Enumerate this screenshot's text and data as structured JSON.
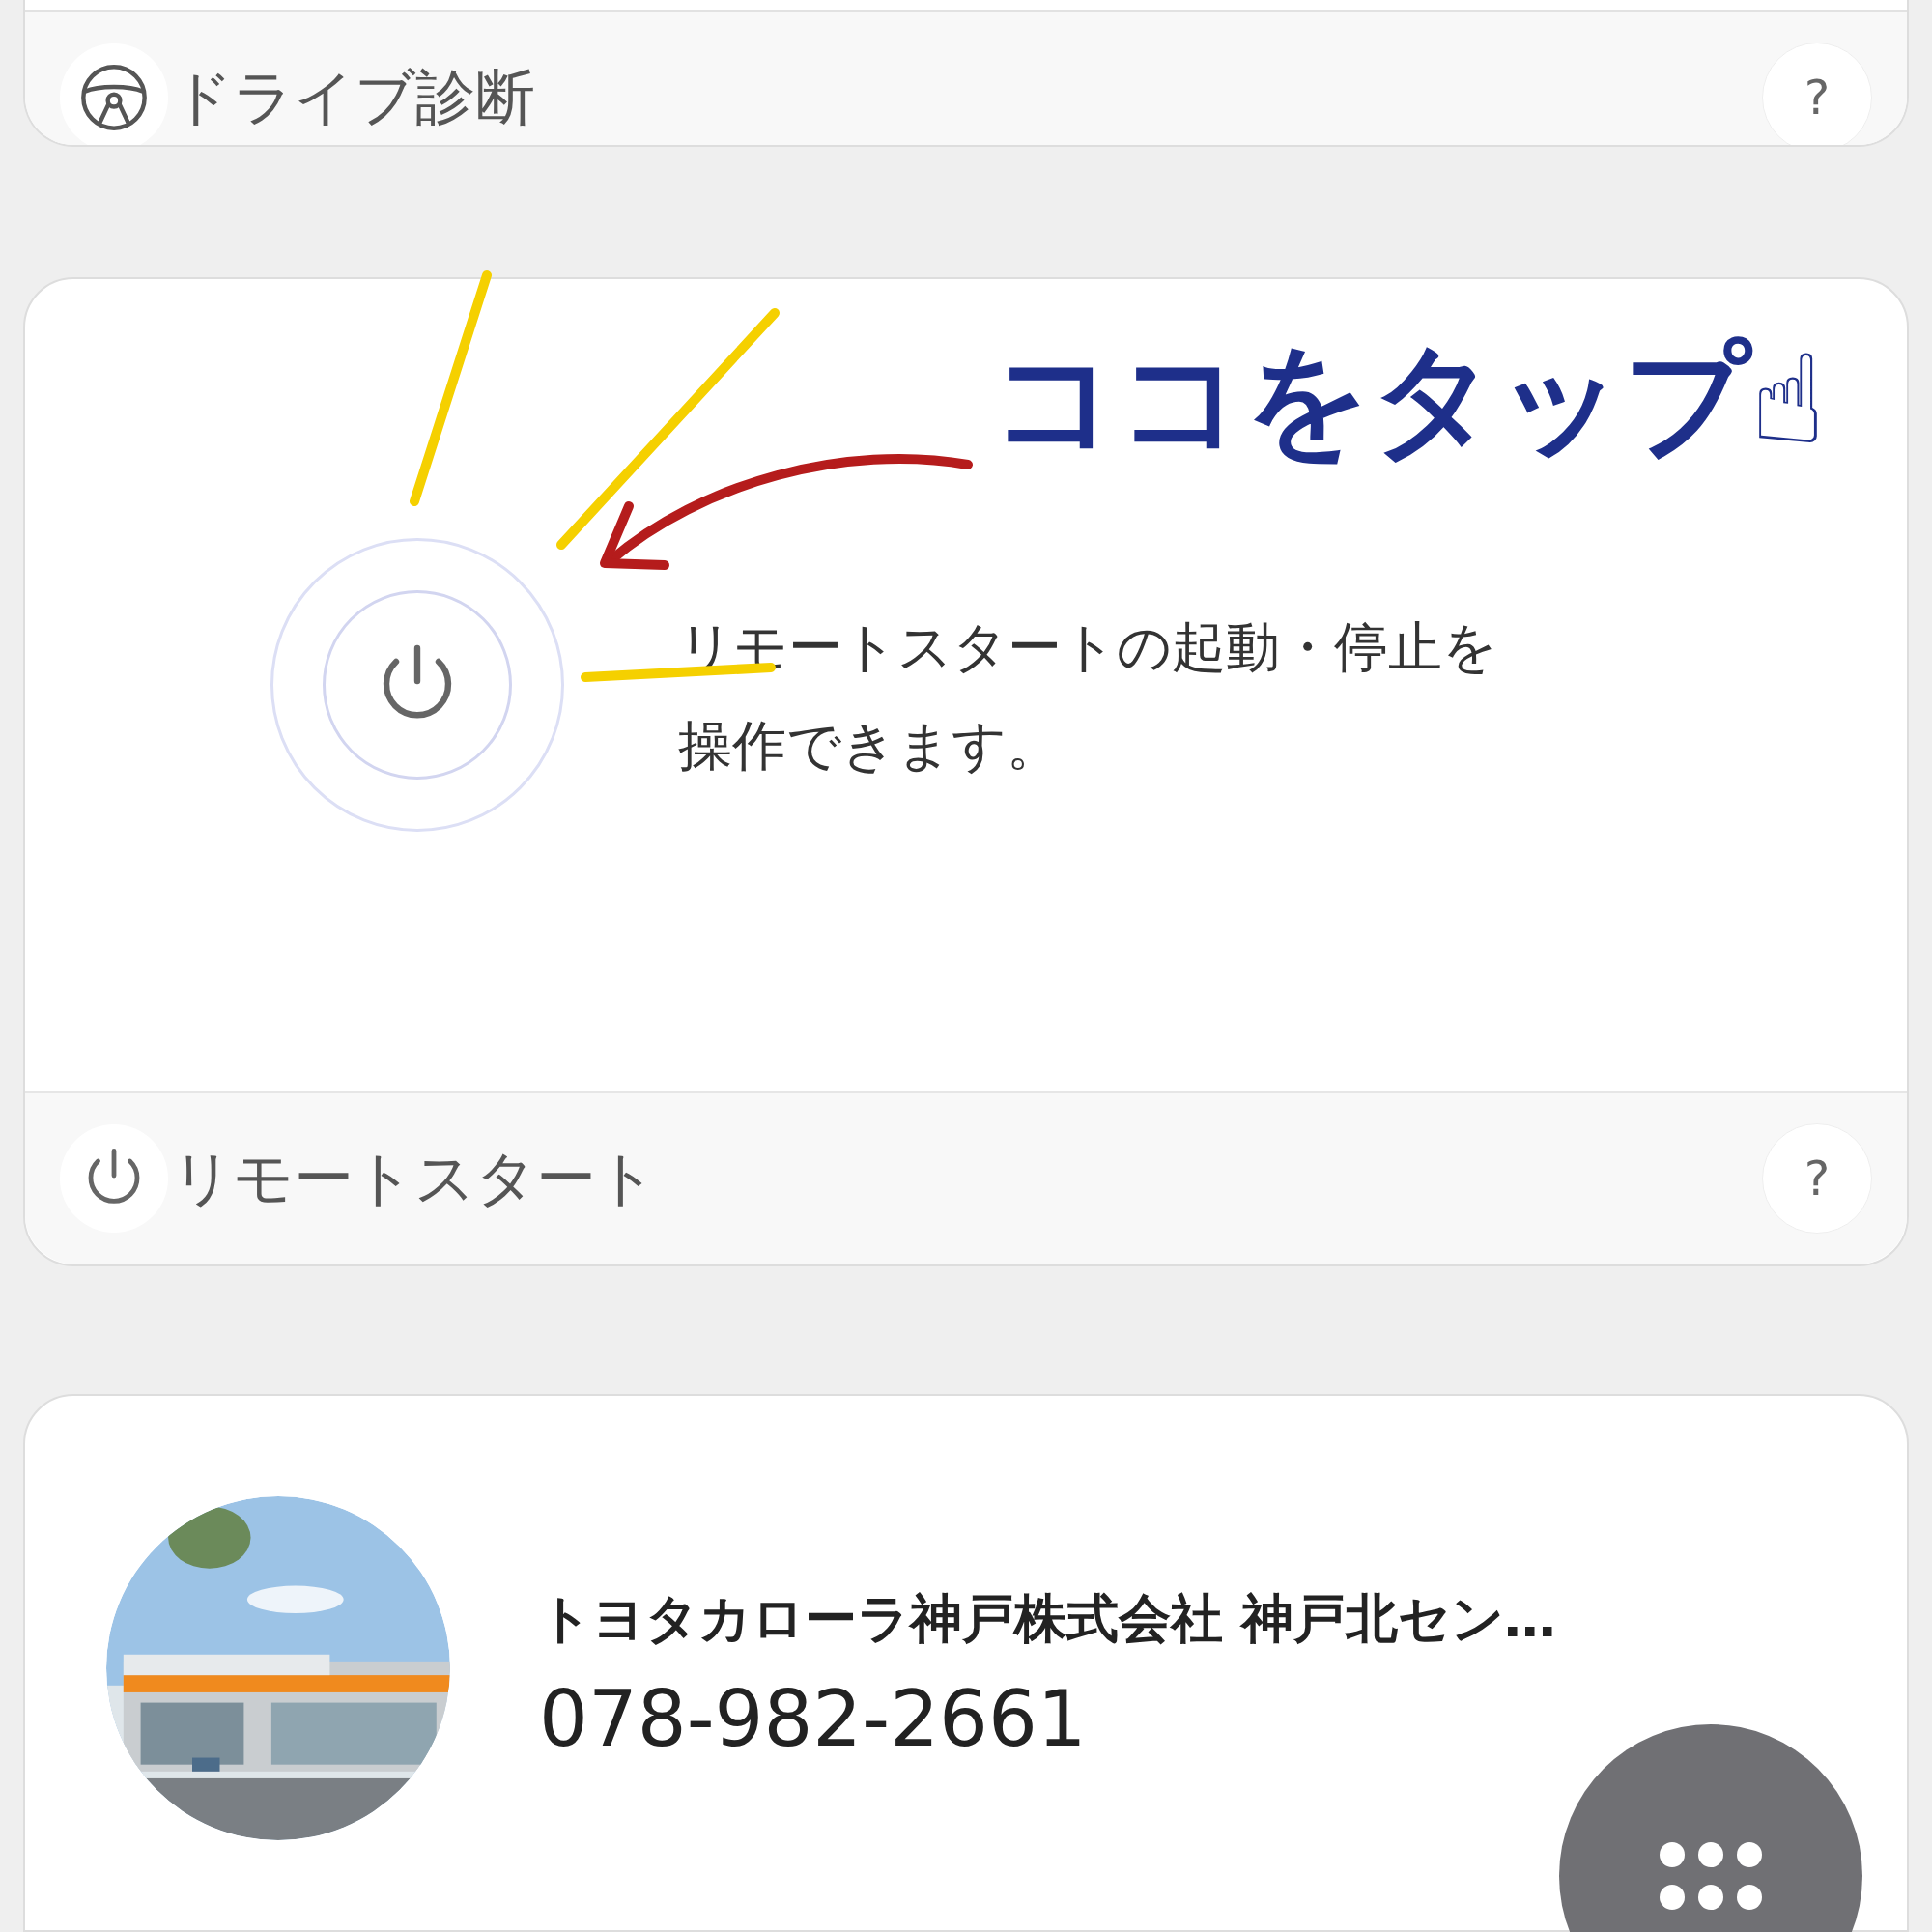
{
  "cards": [
    {
      "kind": "diagnosis",
      "footer": {
        "title": "ドライブ診断",
        "help": "?"
      }
    },
    {
      "kind": "remote_start",
      "description": "リモートスタートの起動・停止を操作できます。",
      "annotation": "ココをタップ☝",
      "footer": {
        "title": "リモートスタート",
        "help": "?"
      }
    }
  ],
  "dealer": {
    "name": "トヨタカローラ神戸株式会社 神戸北セン…",
    "phone": "078-982-2661"
  }
}
